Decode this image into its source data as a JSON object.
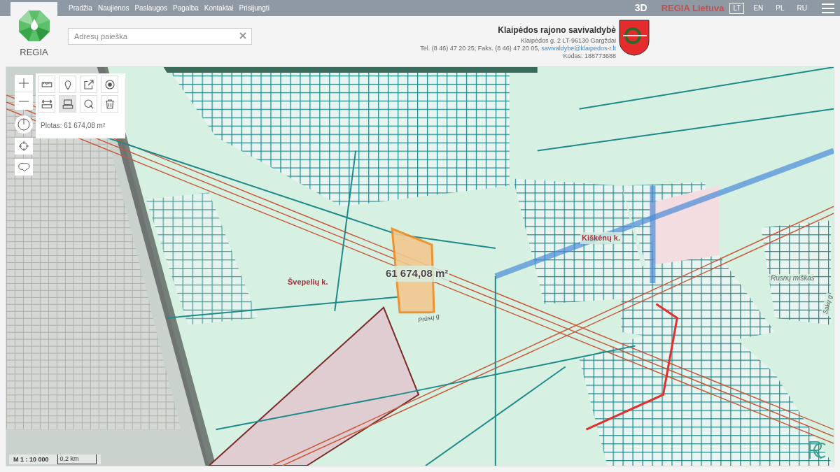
{
  "nav": [
    {
      "label": "Pradžia"
    },
    {
      "label": "Naujienos"
    },
    {
      "label": "Paslaugos"
    },
    {
      "label": "Pagalba"
    },
    {
      "label": "Kontaktai"
    },
    {
      "label": "Prisijungti"
    }
  ],
  "top_right": {
    "mode": "3D",
    "brand": "REGIA Lietuva"
  },
  "languages": [
    {
      "label": "LT",
      "selected": true
    },
    {
      "label": "EN",
      "selected": false
    },
    {
      "label": "PL",
      "selected": false
    },
    {
      "label": "RU",
      "selected": false
    }
  ],
  "logo": {
    "text": "REGIA"
  },
  "search": {
    "placeholder": "Adresų paieška"
  },
  "municipality": {
    "name": "Klaipėdos rajono savivaldybė",
    "address": "Klaipėdos g. 2 LT-96130 Gargždai",
    "phone": "Tel. (8 46) 47 20 25; Faks. (8 46) 47 20 05, ",
    "email": "savivaldybe@klaipedos-r.lt",
    "code": "Kodas: 188773688"
  },
  "tools": [
    [
      {
        "kind": "measure",
        "selected": false
      },
      {
        "kind": "pin",
        "selected": false
      },
      {
        "kind": "export",
        "selected": false
      },
      {
        "kind": "point",
        "selected": false
      }
    ],
    [
      {
        "kind": "distance",
        "selected": false
      },
      {
        "kind": "area",
        "selected": true
      },
      {
        "kind": "search",
        "selected": false
      },
      {
        "kind": "delete",
        "selected": false
      }
    ]
  ],
  "measure_result": "Plotas: 61 674,08 m²",
  "map_labels": [
    {
      "kind": "village",
      "text": "Švepelių k."
    },
    {
      "kind": "area",
      "text": "61 674,08 m²"
    },
    {
      "kind": "street",
      "text": "Prūsų g"
    },
    {
      "kind": "village",
      "text": "Kiškėnų k."
    },
    {
      "kind": "forest",
      "text": "Rusnų miškas"
    },
    {
      "kind": "street",
      "text": "Sakų g"
    }
  ],
  "scale": {
    "ratio": "M 1 : 10 000",
    "bar": "0,2 km"
  }
}
